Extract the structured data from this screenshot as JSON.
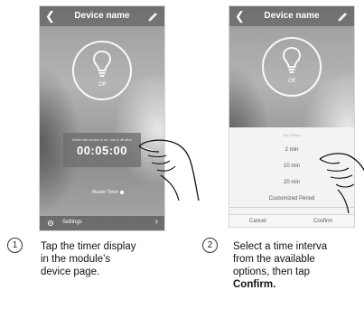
{
  "header": {
    "title": "Device name"
  },
  "phone1": {
    "state": "Off",
    "timer_caption": "When the device is on, turn it off after",
    "timer_value": "00:05:00",
    "master_timer": "Master Timer",
    "settings_label": "Settings"
  },
  "phone2": {
    "state": "Off",
    "sheet_title": "Set Period",
    "options": [
      "2 min",
      "10 min",
      "20 min",
      "Customized Period"
    ],
    "cancel": "Cancel",
    "confirm": "Confirm"
  },
  "steps": [
    {
      "number": "1",
      "lines": [
        "Tap the timer display",
        "in the module’s",
        "device page."
      ]
    },
    {
      "number": "2",
      "lines": [
        "Select a time interva",
        "from the available",
        "options, then tap"
      ],
      "bold_line": "Confirm."
    }
  ],
  "icons": [
    "back-arrow-icon",
    "pencil-icon",
    "bulb-icon",
    "gear-icon",
    "chevron-right-icon",
    "hand-pointer-icon"
  ]
}
